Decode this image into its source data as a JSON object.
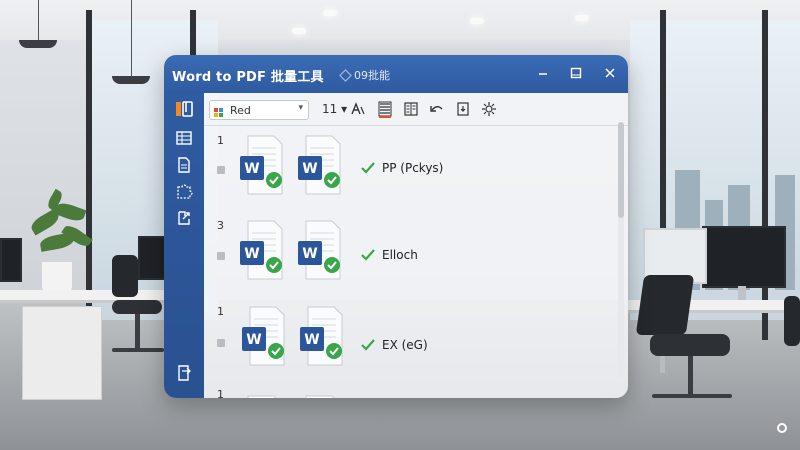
{
  "app": {
    "title": "Word to PDF 批量工具",
    "subtitle": "09批能"
  },
  "toolbar": {
    "font_value": "Red",
    "size_label": "11 ▾",
    "buttons": [
      "text-format-icon",
      "list-icon",
      "columns-icon",
      "undo-icon",
      "export-icon",
      "settings-icon"
    ]
  },
  "sidebar": {
    "items": [
      "app-logo-icon",
      "grid-icon",
      "document-icon",
      "puzzle-icon",
      "share-icon",
      "exit-icon"
    ]
  },
  "files": [
    {
      "index": "1",
      "status": "PP (Pckys)"
    },
    {
      "index": "3",
      "status": "Elloch"
    },
    {
      "index": "1",
      "status": "EX (eG)"
    },
    {
      "index": "1",
      "status": ""
    }
  ],
  "colors": {
    "titlebar": "#2e5aa0",
    "sidebar": "#2a5190",
    "word_blue": "#2b579a",
    "check_green": "#3aa64a"
  }
}
